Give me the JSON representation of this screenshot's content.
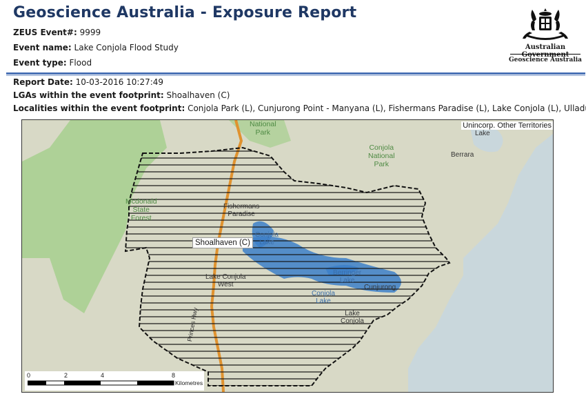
{
  "header": {
    "title": "Geoscience Australia - Exposure Report",
    "zeus_label": "ZEUS Event#:",
    "zeus_value": "9999",
    "event_name_label": "Event name:",
    "event_name_value": "Lake Conjola Flood Study",
    "event_type_label": "Event type:",
    "event_type_value": "Flood"
  },
  "logo": {
    "line1": "Australian Government",
    "line2": "Geoscience Australia"
  },
  "details": {
    "report_date_label": "Report Date:",
    "report_date_value": "10-03-2016 10:27:49",
    "lgas_label": "LGAs within the event footprint:",
    "lgas_value": "Shoalhaven (C)",
    "localities_label": "Localities within the event footprint:",
    "localities_value": "Conjola Park (L), Cunjurong Point - Manyana (L), Fishermans Paradise (L), Lake Conjola (L), Ulladulla"
  },
  "map": {
    "territories_label": "Unincorp. Other Territories",
    "lga_label": "Shoalhaven (C)",
    "place_labels": {
      "national_park_top": "National\nPark",
      "conjola_national_park": "Conjola\nNational\nPark",
      "mcdonald_state_forest": "Mcdonald\nState\nForest",
      "berrara": "Berrara",
      "lake_top_right": "Lake",
      "fishermans_paradise": "Fishermans\nParadise",
      "conjola_lake": "Conjola\nLake",
      "lake_conjola_west": "Lake Conjola\nWest",
      "berringer_lake": "Berringer\nLake",
      "cunjurong": "Cunjurong",
      "conjola_lake_2": "Conjola\nLake",
      "lake_conjola": "Lake\nConjola",
      "highway": "Princes Hwy"
    },
    "scale": {
      "ticks": [
        "0",
        "2",
        "4",
        "8"
      ],
      "unit": "Kilometres"
    },
    "colors": {
      "ocean": "#c9d7dc",
      "land": "#d8d9c6",
      "forest": "#a7cf8e",
      "water": "#3d7fc8",
      "road": "#e0922f"
    }
  }
}
